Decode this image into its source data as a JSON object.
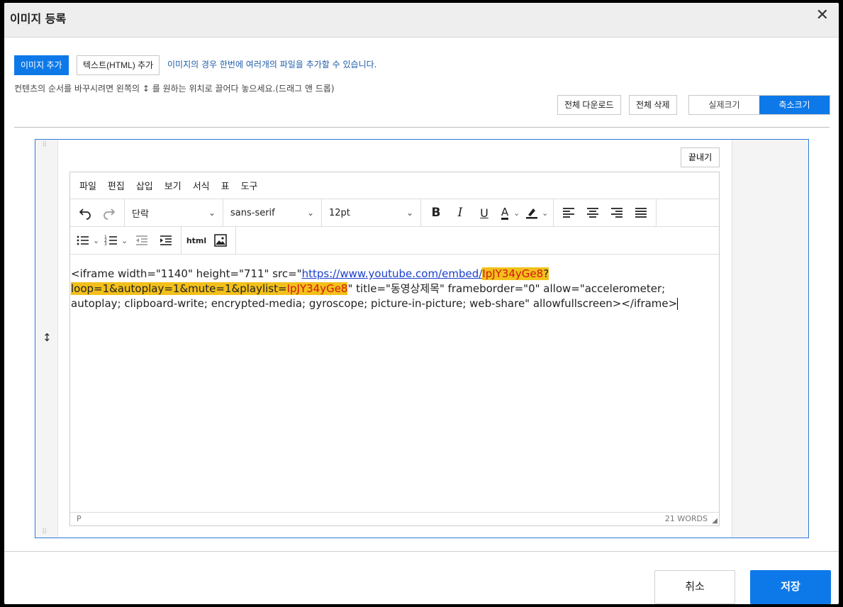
{
  "dialog": {
    "title": "이미지 등록",
    "close_glyph": "✕"
  },
  "actions": {
    "add_image": "이미지 추가",
    "add_text": "텍스트(HTML) 추가",
    "info": "이미지의 경우 한번에 여러개의 파일을 추가할 수 있습니다.",
    "order_help": "컨텐츠의 순서를 바꾸시려면 왼쪽의 ↕ 를 원하는 위치로 끌어다 놓으세요.(드래그 앤 드롭)",
    "download_all": "전체 다운로드",
    "delete_all": "전체 삭제",
    "actual_size": "실제크기",
    "reduced_size": "축소크기",
    "reduced_size_selected": true
  },
  "content_block": {
    "finish": "끝내기",
    "drag_handle": "↕"
  },
  "editor": {
    "menu": [
      "파일",
      "편집",
      "삽입",
      "보기",
      "서식",
      "표",
      "도구"
    ],
    "block_format": "단락",
    "font_family": "sans-serif",
    "font_size": "12pt",
    "html_label": "html",
    "status_path": "P",
    "word_count": "21 WORDS",
    "content": {
      "part1": "<iframe width=\"1140\" height=\"711\" src=\"",
      "link": "https://www.youtube.com/embed/",
      "id1": "IpJY34yGe8",
      "q": "?",
      "params": "loop=1&autoplay=1&mute=1&playlist=",
      "id2": "IpJY34yGe8",
      "part2": "\" title=\"동영상제목\" frameborder=\"0\" allow=\"accelerometer; autoplay; clipboard-write; encrypted-media; gyroscope; picture-in-picture; web-share\" allowfullscreen></iframe>"
    }
  },
  "footer": {
    "cancel": "취소",
    "save": "저장"
  },
  "colors": {
    "primary": "#0d79e8",
    "highlight": "#f3c01b",
    "link": "#1a3fcf"
  }
}
